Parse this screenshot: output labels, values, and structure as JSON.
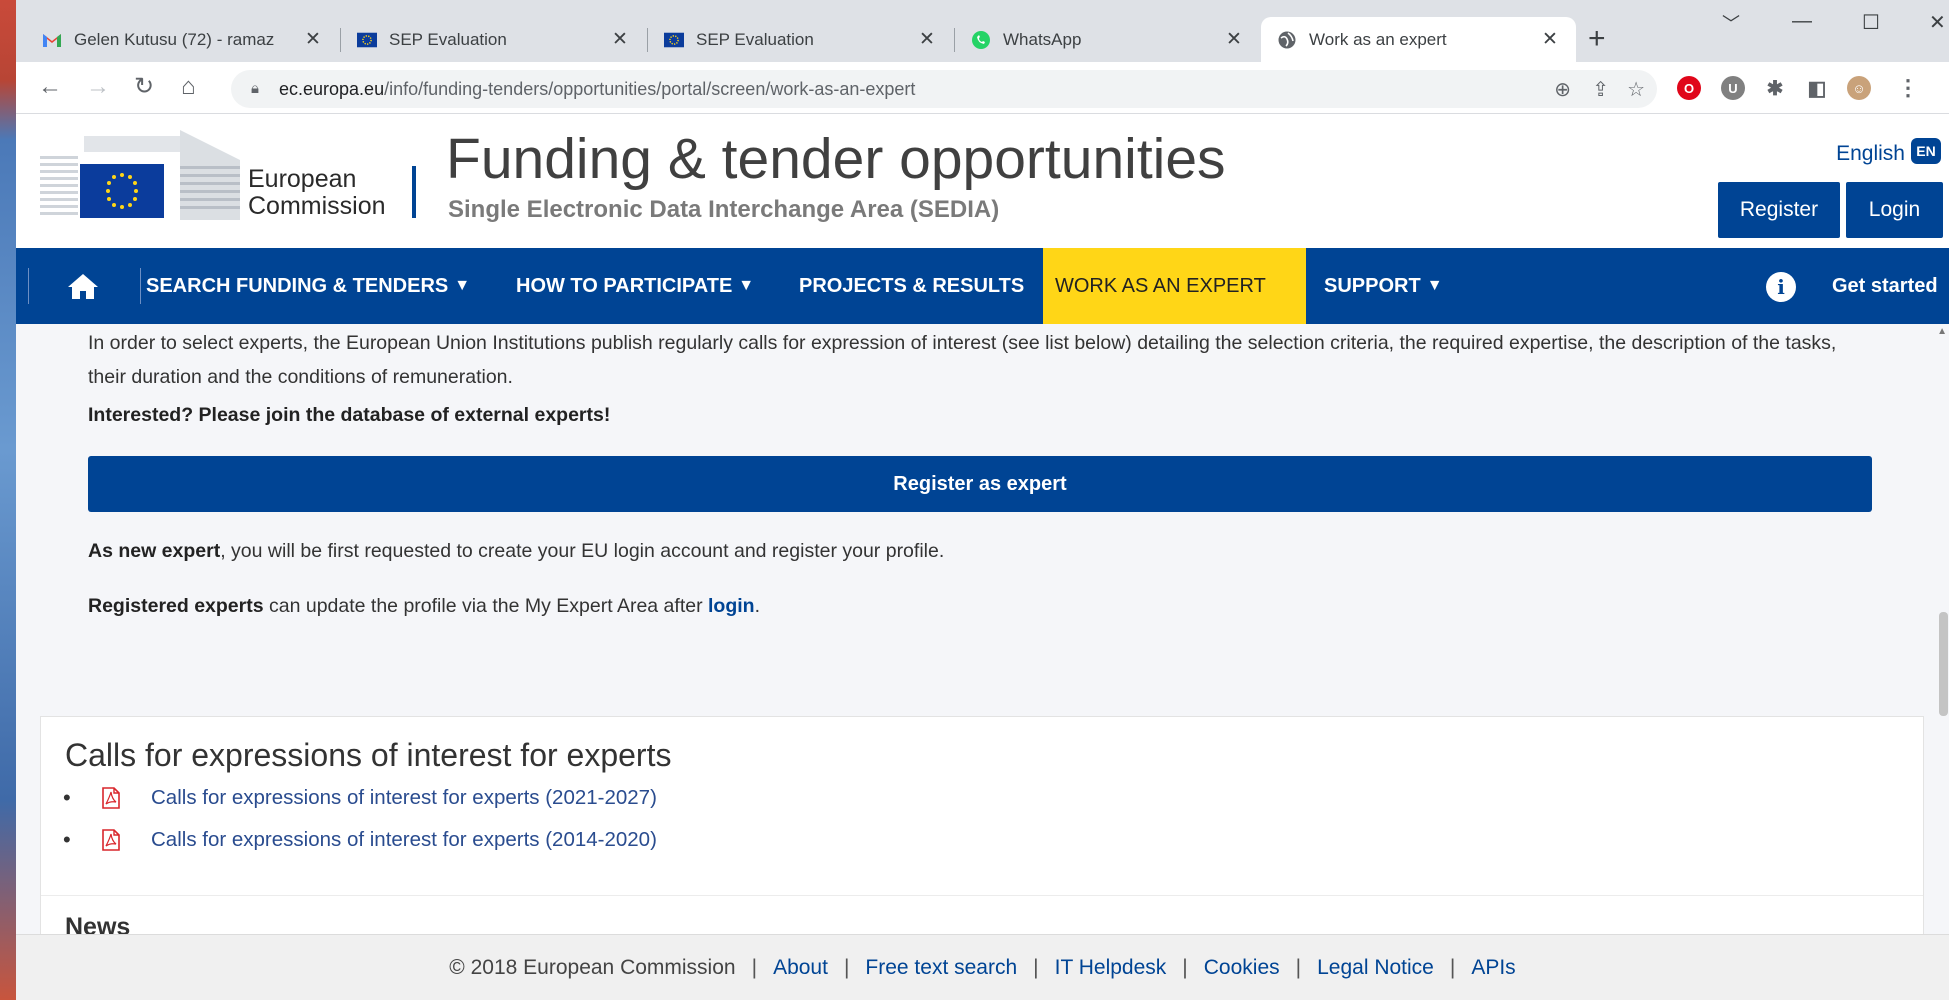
{
  "tabs": [
    {
      "title": "Gelen Kutusu (72) - ramaz",
      "icon": "gmail-icon"
    },
    {
      "title": "SEP Evaluation",
      "icon": "eu-flag-icon"
    },
    {
      "title": "SEP Evaluation",
      "icon": "eu-flag-icon"
    },
    {
      "title": "WhatsApp",
      "icon": "whatsapp-icon"
    },
    {
      "title": "Work as an expert",
      "icon": "globe-icon"
    }
  ],
  "address_bar": {
    "domain": "ec.europa.eu",
    "path": "/info/funding-tenders/opportunities/portal/screen/work-as-an-expert"
  },
  "header": {
    "logo_line1": "European",
    "logo_line2": "Commission",
    "title": "Funding & tender opportunities",
    "subtitle": "Single Electronic Data Interchange Area (SEDIA)",
    "language": "English",
    "language_code": "EN",
    "register_label": "Register",
    "login_label": "Login"
  },
  "nav": {
    "search": "SEARCH FUNDING & TENDERS",
    "participate": "HOW TO PARTICIPATE",
    "projects": "PROJECTS & RESULTS",
    "expert": "WORK AS AN EXPERT",
    "support": "SUPPORT",
    "get_started": "Get started"
  },
  "content": {
    "intro": "In order to select experts, the European Union Institutions publish regularly calls for expression of interest (see list below) detailing the selection criteria, the required expertise, the description of the tasks, their duration and the conditions of remuneration.",
    "interested": "Interested? Please join the database of external experts!",
    "register_button": "Register as expert",
    "new_expert_bold": "As new expert",
    "new_expert_rest": ", you will be first requested to create your EU login account and register your profile.",
    "registered_bold": "Registered experts",
    "registered_rest": " can update the profile via the My Expert Area after ",
    "login_link": "login",
    "registered_end": "."
  },
  "calls": {
    "title": "Calls for expressions of interest for experts",
    "items": [
      "Calls for expressions of interest for experts (2021-2027)",
      "Calls for expressions of interest for experts (2014-2020)"
    ],
    "news_title": "News"
  },
  "footer": {
    "copyright": "© 2018 European Commission",
    "links": [
      "About",
      "Free text search",
      "IT Helpdesk",
      "Cookies",
      "Legal Notice",
      "APIs"
    ]
  },
  "colors": {
    "eu_blue": "#004494",
    "active_nav": "#ffd617",
    "pdf_red": "#d9262c"
  }
}
